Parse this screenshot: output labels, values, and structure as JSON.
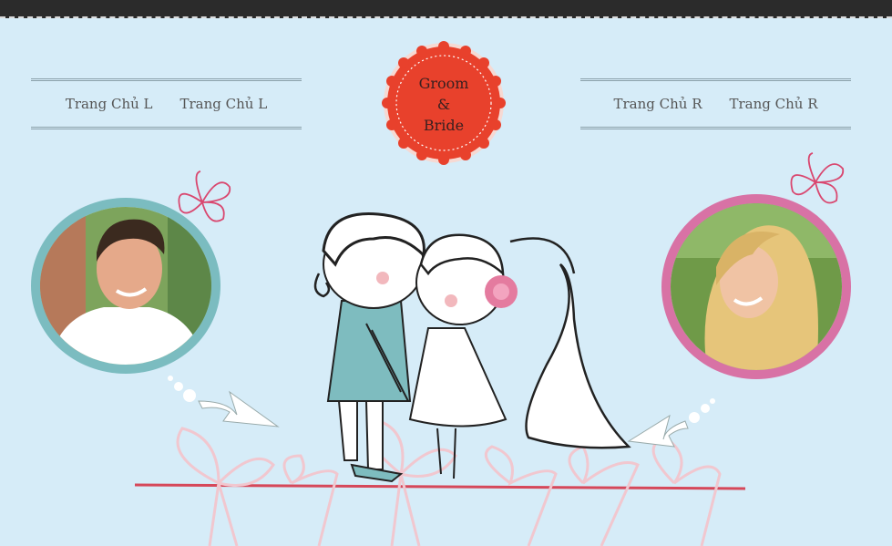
{
  "nav_left": {
    "items": [
      {
        "label": "Trang Chủ L"
      },
      {
        "label": "Trang Chủ L"
      }
    ]
  },
  "nav_right": {
    "items": [
      {
        "label": "Trang Chủ R"
      },
      {
        "label": "Trang Chủ R"
      }
    ]
  },
  "badge": {
    "line1": "Groom",
    "line2": "&",
    "line3": "Bride"
  },
  "colors": {
    "background": "#d6ecf8",
    "topbar": "#2b2b2b",
    "badge_red": "#e8412c",
    "groom_ring": "#7bbcc0",
    "bride_ring": "#d872a5",
    "ribbon_line": "#d6485a"
  },
  "icons": [
    "butterfly-icon",
    "arrow-icon",
    "rose-icon"
  ]
}
